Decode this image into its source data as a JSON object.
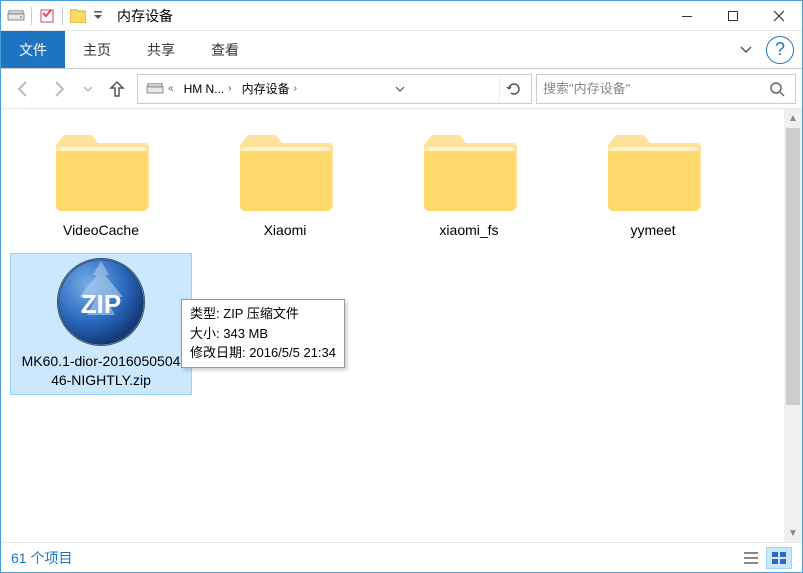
{
  "window": {
    "title": "内存设备"
  },
  "ribbon": {
    "file": "文件",
    "tabs": [
      "主页",
      "共享",
      "查看"
    ]
  },
  "address": {
    "segments": [
      {
        "label": "HM N..."
      },
      {
        "label": "内存设备"
      }
    ]
  },
  "search": {
    "placeholder": "搜索\"内存设备\""
  },
  "items": [
    {
      "name": "VideoCache",
      "type": "folder"
    },
    {
      "name": "Xiaomi",
      "type": "folder"
    },
    {
      "name": "xiaomi_fs",
      "type": "folder"
    },
    {
      "name": "yymeet",
      "type": "folder"
    },
    {
      "name": "MK60.1-dior-201605050446-NIGHTLY.zip",
      "type": "zip",
      "selected": true
    }
  ],
  "tooltip": {
    "type_label": "类型:",
    "type_value": "ZIP 压缩文件",
    "size_label": "大小:",
    "size_value": "343 MB",
    "modified_label": "修改日期:",
    "modified_value": "2016/5/5 21:34"
  },
  "status": {
    "count": "61 个项目"
  }
}
